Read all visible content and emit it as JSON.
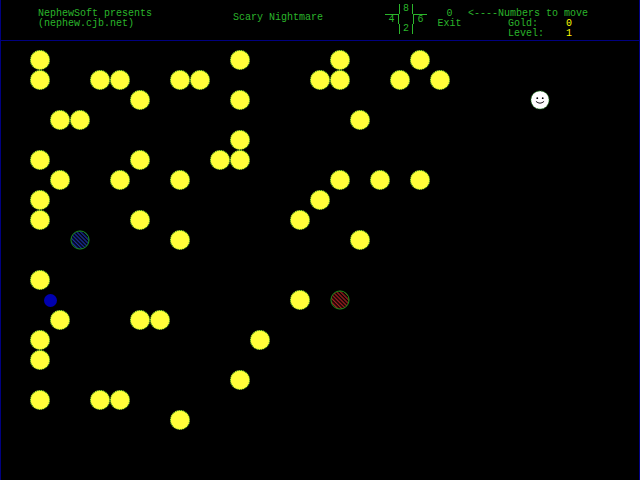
{
  "header": {
    "credits": [
      "NephewSoft presents",
      "(nephew.cjb.net)"
    ],
    "title": "Scary Nightmare",
    "keypad": {
      "up": "8",
      "left": "4",
      "right": "6",
      "down": "2"
    },
    "exit": {
      "key": "0",
      "label": "Exit"
    },
    "hint": "<----Numbers to move",
    "stats": [
      {
        "label": "Gold:",
        "value": "0"
      },
      {
        "label": "Level:",
        "value": "1"
      }
    ]
  },
  "board": {
    "items": [
      {
        "kind": "gold",
        "col": 2,
        "row": 3
      },
      {
        "kind": "gold",
        "col": 12,
        "row": 3
      },
      {
        "kind": "gold",
        "col": 17,
        "row": 3
      },
      {
        "kind": "gold",
        "col": 21,
        "row": 3
      },
      {
        "kind": "gold",
        "col": 2,
        "row": 4
      },
      {
        "kind": "gold",
        "col": 5,
        "row": 4
      },
      {
        "kind": "gold",
        "col": 6,
        "row": 4
      },
      {
        "kind": "gold",
        "col": 9,
        "row": 4
      },
      {
        "kind": "gold",
        "col": 10,
        "row": 4
      },
      {
        "kind": "gold",
        "col": 16,
        "row": 4
      },
      {
        "kind": "gold",
        "col": 17,
        "row": 4
      },
      {
        "kind": "gold",
        "col": 20,
        "row": 4
      },
      {
        "kind": "gold",
        "col": 22,
        "row": 4
      },
      {
        "kind": "gold",
        "col": 7,
        "row": 5
      },
      {
        "kind": "gold",
        "col": 12,
        "row": 5
      },
      {
        "kind": "gold",
        "col": 3,
        "row": 6
      },
      {
        "kind": "gold",
        "col": 4,
        "row": 6
      },
      {
        "kind": "gold",
        "col": 18,
        "row": 6
      },
      {
        "kind": "gold",
        "col": 12,
        "row": 7
      },
      {
        "kind": "gold",
        "col": 2,
        "row": 8
      },
      {
        "kind": "gold",
        "col": 7,
        "row": 8
      },
      {
        "kind": "gold",
        "col": 11,
        "row": 8
      },
      {
        "kind": "gold",
        "col": 12,
        "row": 8
      },
      {
        "kind": "gold",
        "col": 3,
        "row": 9
      },
      {
        "kind": "gold",
        "col": 6,
        "row": 9
      },
      {
        "kind": "gold",
        "col": 9,
        "row": 9
      },
      {
        "kind": "gold",
        "col": 17,
        "row": 9
      },
      {
        "kind": "gold",
        "col": 19,
        "row": 9
      },
      {
        "kind": "gold",
        "col": 21,
        "row": 9
      },
      {
        "kind": "gold",
        "col": 2,
        "row": 10
      },
      {
        "kind": "gold",
        "col": 16,
        "row": 10
      },
      {
        "kind": "gold",
        "col": 2,
        "row": 11
      },
      {
        "kind": "gold",
        "col": 7,
        "row": 11
      },
      {
        "kind": "gold",
        "col": 15,
        "row": 11
      },
      {
        "kind": "gold",
        "col": 9,
        "row": 12
      },
      {
        "kind": "gold",
        "col": 18,
        "row": 12
      },
      {
        "kind": "gold",
        "col": 2,
        "row": 14
      },
      {
        "kind": "gold",
        "col": 15,
        "row": 15
      },
      {
        "kind": "gold",
        "col": 3,
        "row": 16
      },
      {
        "kind": "gold",
        "col": 7,
        "row": 16
      },
      {
        "kind": "gold",
        "col": 8,
        "row": 16
      },
      {
        "kind": "gold",
        "col": 2,
        "row": 17
      },
      {
        "kind": "gold",
        "col": 13,
        "row": 17
      },
      {
        "kind": "gold",
        "col": 2,
        "row": 18
      },
      {
        "kind": "gold",
        "col": 12,
        "row": 19
      },
      {
        "kind": "gold",
        "col": 2,
        "row": 20
      },
      {
        "kind": "gold",
        "col": 5,
        "row": 20
      },
      {
        "kind": "gold",
        "col": 6,
        "row": 20
      },
      {
        "kind": "gold",
        "col": 9,
        "row": 21
      },
      {
        "kind": "player",
        "col": 27,
        "row": 5
      },
      {
        "kind": "monster",
        "col": 4,
        "row": 12,
        "color": "#1a2f9a"
      },
      {
        "kind": "monster",
        "col": 17,
        "row": 15,
        "color": "#a02020"
      },
      {
        "kind": "dot",
        "col": 2.5,
        "row": 15,
        "color": "#0000b0"
      }
    ]
  }
}
